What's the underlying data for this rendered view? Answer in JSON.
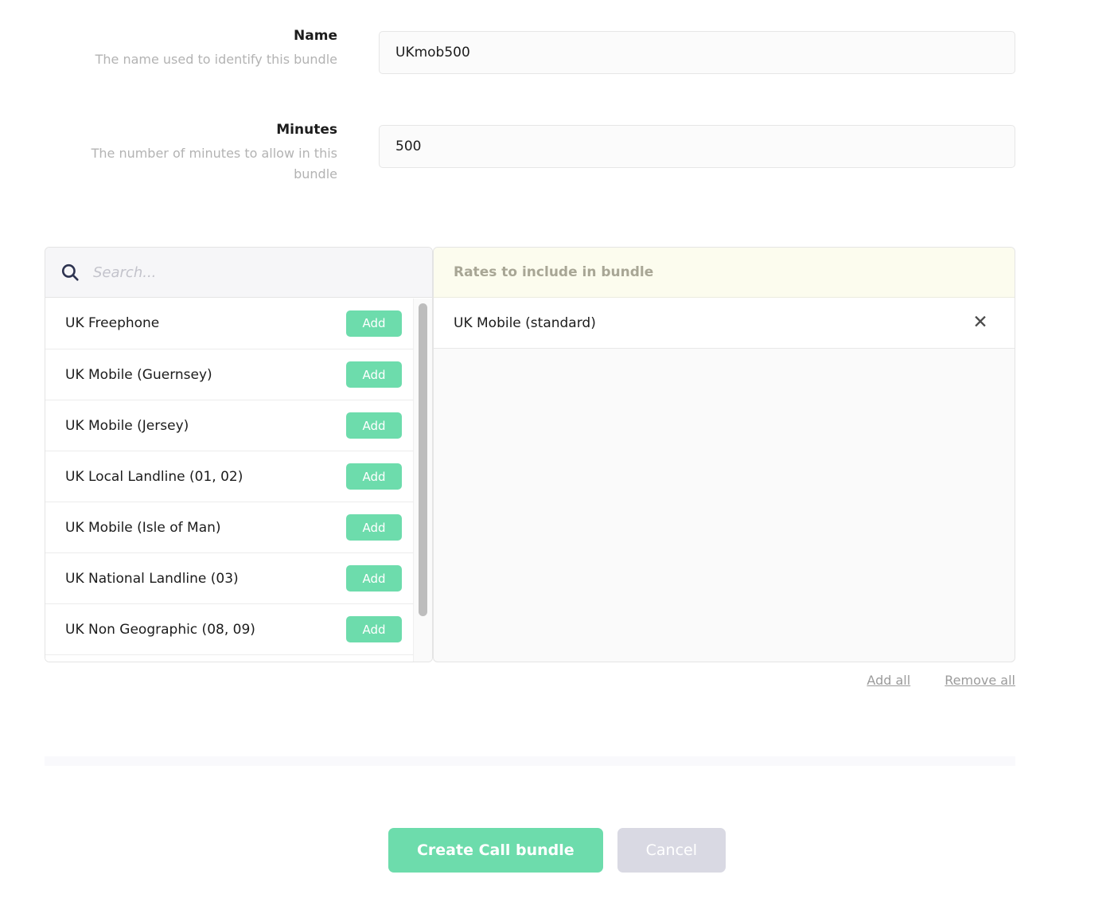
{
  "form": {
    "fields": [
      {
        "label": "Name",
        "help": "The name used to identify this bundle",
        "value": "UKmob500",
        "placeholder": ""
      },
      {
        "label": "Minutes",
        "help": "The number of minutes to allow in this bundle",
        "value": "500",
        "placeholder": ""
      }
    ]
  },
  "picker": {
    "search": {
      "placeholder": "Search...",
      "value": "",
      "icon": "search-icon"
    },
    "available": {
      "add_label": "Add",
      "items": [
        {
          "name": "UK Freephone"
        },
        {
          "name": "UK Mobile (Guernsey)"
        },
        {
          "name": "UK Mobile (Jersey)"
        },
        {
          "name": "UK Local Landline (01, 02)"
        },
        {
          "name": "UK Mobile (Isle of Man)"
        },
        {
          "name": "UK National Landline (03)"
        },
        {
          "name": "UK Non Geographic (08, 09)"
        }
      ]
    },
    "selected": {
      "header": "Rates to include in bundle",
      "remove_icon": "✕",
      "items": [
        {
          "name": "UK Mobile (standard)"
        }
      ]
    },
    "bulk": {
      "add_all": "Add all",
      "remove_all": "Remove all"
    }
  },
  "footer": {
    "submit_label": "Create Call bundle",
    "cancel_label": "Cancel"
  },
  "colors": {
    "accent_green": "#6ddcac",
    "cancel_grey": "#d9d9e3",
    "selected_header_bg": "#fcfcee",
    "search_bg": "#f6f6f8"
  }
}
